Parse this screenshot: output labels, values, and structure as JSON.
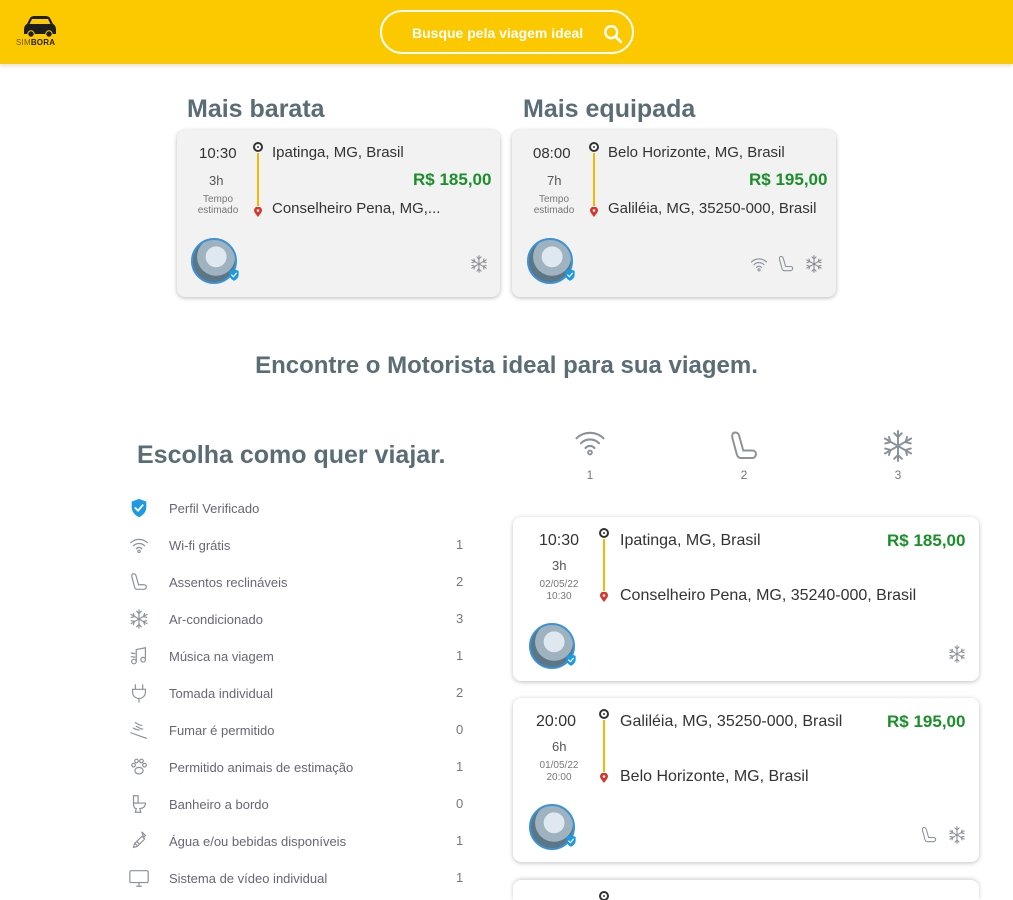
{
  "brand": {
    "prefix": "SIM",
    "name": "BORA"
  },
  "search": {
    "placeholder": "Busque pela viagem ideal"
  },
  "highlights": {
    "cheapest_title": "Mais barata",
    "equipped_title": "Mais equipada",
    "cards": [
      {
        "time": "10:30",
        "duration": "3h",
        "duration_label": "Tempo estimado",
        "origin": "Ipatinga, MG, Brasil",
        "destination": "Conselheiro Pena, MG,...",
        "price": "R$ 185,00",
        "amenities": [
          "snowflake-icon"
        ]
      },
      {
        "time": "08:00",
        "duration": "7h",
        "duration_label": "Tempo estimado",
        "origin": "Belo Horizonte, MG, Brasil",
        "destination": "Galiléia, MG, 35250-000, Brasil",
        "price": "R$ 195,00",
        "amenities": [
          "wifi-icon",
          "seat-icon",
          "snowflake-icon"
        ]
      }
    ]
  },
  "find_title": "Encontre o Motorista ideal para sua viagem.",
  "filters": {
    "title": "Escolha como quer viajar.",
    "items": [
      {
        "label": "Perfil Verificado",
        "count": "",
        "icon": "verified-shield-icon"
      },
      {
        "label": "Wi-fi grátis",
        "count": "1",
        "icon": "wifi-icon"
      },
      {
        "label": "Assentos reclináveis",
        "count": "2",
        "icon": "seat-icon"
      },
      {
        "label": "Ar-condicionado",
        "count": "3",
        "icon": "snowflake-icon"
      },
      {
        "label": "Música na viagem",
        "count": "1",
        "icon": "music-icon"
      },
      {
        "label": "Tomada individual",
        "count": "2",
        "icon": "plug-icon"
      },
      {
        "label": "Fumar é permitido",
        "count": "0",
        "icon": "smoking-icon"
      },
      {
        "label": "Permitido animais de estimação",
        "count": "1",
        "icon": "paw-icon"
      },
      {
        "label": "Banheiro a bordo",
        "count": "0",
        "icon": "toilet-icon"
      },
      {
        "label": "Água e/ou bebidas disponíveis",
        "count": "1",
        "icon": "bottle-icon"
      },
      {
        "label": "Sistema de vídeo individual",
        "count": "1",
        "icon": "monitor-icon"
      }
    ]
  },
  "amenity_columns": [
    {
      "icon": "wifi-icon",
      "count": "1"
    },
    {
      "icon": "seat-icon",
      "count": "2"
    },
    {
      "icon": "snowflake-icon",
      "count": "3"
    }
  ],
  "trips": [
    {
      "time": "10:30",
      "duration": "3h",
      "date": "02/05/22",
      "date_time": "10:30",
      "origin": "Ipatinga, MG, Brasil",
      "destination": "Conselheiro Pena, MG, 35240-000, Brasil",
      "price": "R$ 185,00"
    },
    {
      "time": "20:00",
      "duration": "6h",
      "date": "01/05/22",
      "date_time": "20:00",
      "origin": "Galiléia, MG, 35250-000, Brasil",
      "destination": "Belo Horizonte, MG, Brasil",
      "price": "R$ 195,00"
    }
  ]
}
